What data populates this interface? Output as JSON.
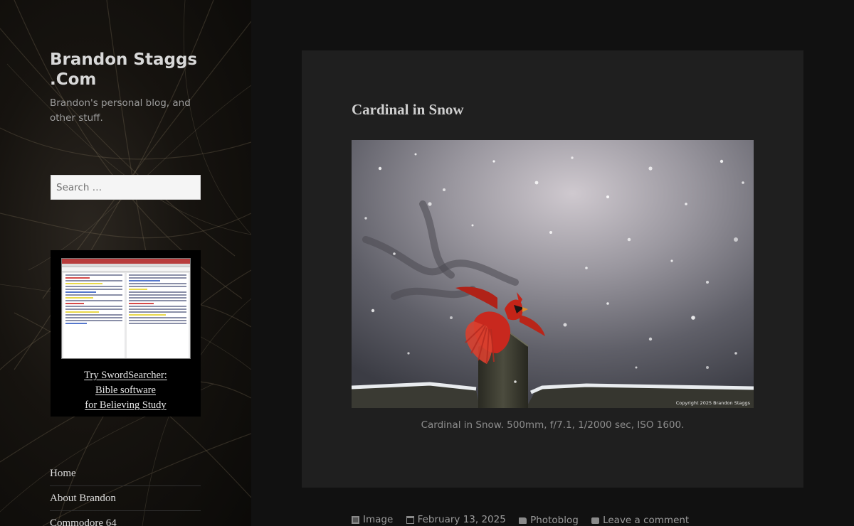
{
  "site": {
    "title_line1": "Brandon Staggs",
    "title_line2": ".Com",
    "description": "Brandon's personal blog, and other stuff."
  },
  "search": {
    "placeholder": "Search …"
  },
  "ad": {
    "line1": "Try SwordSearcher:",
    "line2": "Bible software",
    "line3": "for Believing Study"
  },
  "nav": {
    "items": [
      {
        "label": "Home"
      },
      {
        "label": "About Brandon"
      },
      {
        "label": "Commodore 64"
      }
    ]
  },
  "post": {
    "title": "Cardinal in Snow",
    "photo_copyright": "Copyright 2025 Brandon Staggs",
    "caption": "Cardinal in Snow. 500mm, f/7.1, 1/2000 sec, ISO 1600.",
    "meta": {
      "format": "Image",
      "date": "February 13, 2025",
      "category": "Photoblog",
      "comments": "Leave a comment"
    }
  },
  "colors": {
    "background": "#111111",
    "card": "#1f1f1f",
    "cardinal_red": "#c8281e"
  },
  "icons": [
    "image-format-icon",
    "calendar-icon",
    "folder-icon",
    "comment-icon"
  ]
}
